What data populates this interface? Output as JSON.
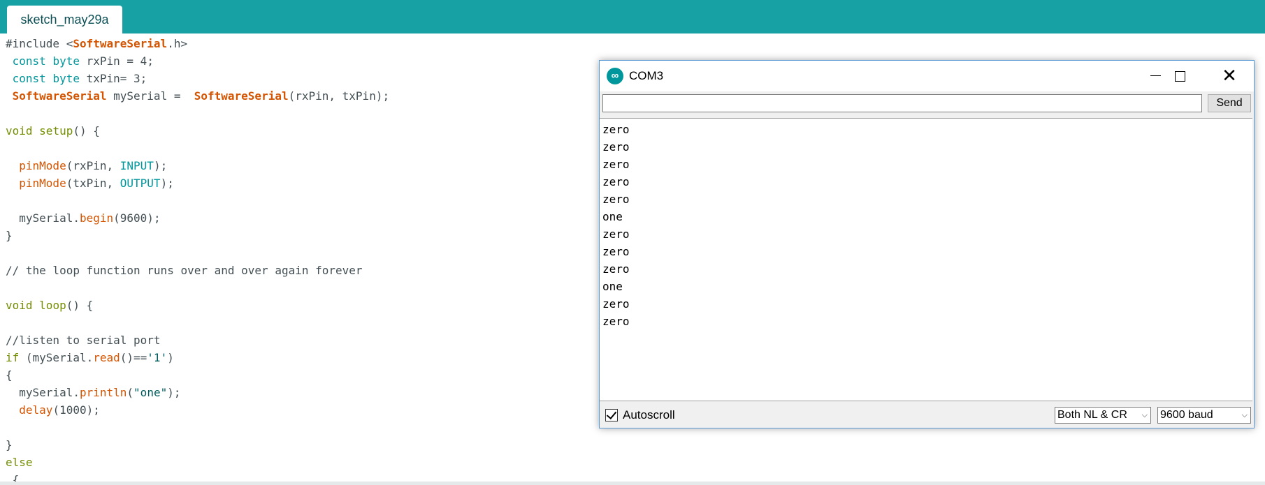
{
  "ide": {
    "tab_label": "sketch_may29a",
    "code_lines": [
      [
        {
          "t": "#include <",
          "c": ""
        },
        {
          "t": "SoftwareSerial",
          "c": "cls"
        },
        {
          "t": ".h>",
          "c": ""
        }
      ],
      [
        {
          "t": " ",
          "c": ""
        },
        {
          "t": "const",
          "c": "const"
        },
        {
          "t": " ",
          "c": ""
        },
        {
          "t": "byte",
          "c": "const"
        },
        {
          "t": " rxPin = 4;",
          "c": ""
        }
      ],
      [
        {
          "t": " ",
          "c": ""
        },
        {
          "t": "const",
          "c": "const"
        },
        {
          "t": " ",
          "c": ""
        },
        {
          "t": "byte",
          "c": "const"
        },
        {
          "t": " txPin= 3;",
          "c": ""
        }
      ],
      [
        {
          "t": " ",
          "c": ""
        },
        {
          "t": "SoftwareSerial",
          "c": "cls"
        },
        {
          "t": " mySerial =  ",
          "c": ""
        },
        {
          "t": "SoftwareSerial",
          "c": "cls"
        },
        {
          "t": "(rxPin, txPin);",
          "c": ""
        }
      ],
      [],
      [
        {
          "t": "void",
          "c": "kw"
        },
        {
          "t": " ",
          "c": ""
        },
        {
          "t": "setup",
          "c": "kw"
        },
        {
          "t": "() {",
          "c": ""
        }
      ],
      [],
      [
        {
          "t": "  ",
          "c": ""
        },
        {
          "t": "pinMode",
          "c": "fn"
        },
        {
          "t": "(rxPin, ",
          "c": ""
        },
        {
          "t": "INPUT",
          "c": "const"
        },
        {
          "t": ");",
          "c": ""
        }
      ],
      [
        {
          "t": "  ",
          "c": ""
        },
        {
          "t": "pinMode",
          "c": "fn"
        },
        {
          "t": "(txPin, ",
          "c": ""
        },
        {
          "t": "OUTPUT",
          "c": "const"
        },
        {
          "t": ");",
          "c": ""
        }
      ],
      [],
      [
        {
          "t": "  mySerial.",
          "c": ""
        },
        {
          "t": "begin",
          "c": "fn"
        },
        {
          "t": "(9600);",
          "c": ""
        }
      ],
      [
        {
          "t": "}",
          "c": ""
        }
      ],
      [],
      [
        {
          "t": "// the loop function runs over and over again forever",
          "c": "cm"
        }
      ],
      [],
      [
        {
          "t": "void",
          "c": "kw"
        },
        {
          "t": " ",
          "c": ""
        },
        {
          "t": "loop",
          "c": "kw"
        },
        {
          "t": "() {",
          "c": ""
        }
      ],
      [],
      [
        {
          "t": "//listen to serial port",
          "c": "cm"
        }
      ],
      [
        {
          "t": "if",
          "c": "kw"
        },
        {
          "t": " (mySerial.",
          "c": ""
        },
        {
          "t": "read",
          "c": "fn"
        },
        {
          "t": "()==",
          "c": ""
        },
        {
          "t": "'1'",
          "c": "str"
        },
        {
          "t": ")",
          "c": ""
        }
      ],
      [
        {
          "t": "{",
          "c": ""
        }
      ],
      [
        {
          "t": "  mySerial.",
          "c": ""
        },
        {
          "t": "println",
          "c": "fn"
        },
        {
          "t": "(",
          "c": ""
        },
        {
          "t": "\"one\"",
          "c": "str"
        },
        {
          "t": ");",
          "c": ""
        }
      ],
      [
        {
          "t": "  ",
          "c": ""
        },
        {
          "t": "delay",
          "c": "fn"
        },
        {
          "t": "(1000);",
          "c": ""
        }
      ],
      [],
      [
        {
          "t": "}",
          "c": ""
        }
      ],
      [
        {
          "t": "else",
          "c": "kw"
        }
      ],
      [
        {
          "t": " {",
          "c": ""
        }
      ]
    ]
  },
  "monitor": {
    "title": "COM3",
    "logo_glyph": "∞",
    "minimize_icon": "minimize-icon",
    "maximize_icon": "maximize-icon",
    "close_glyph": "✕",
    "input_value": "",
    "send_label": "Send",
    "output_lines": [
      "zero",
      "zero",
      "zero",
      "zero",
      "zero",
      "one",
      "zero",
      "zero",
      "zero",
      "one",
      "zero",
      "zero"
    ],
    "autoscroll_label": "Autoscroll",
    "autoscroll_checked": true,
    "line_ending": "Both NL & CR",
    "baud": "9600 baud",
    "chevron_glyph": "⌵"
  },
  "colors": {
    "topbar": "#17a1a5",
    "keyword": "#728e00",
    "function": "#d35400",
    "constant": "#00979c",
    "string": "#005c5f",
    "text": "#434f54"
  }
}
